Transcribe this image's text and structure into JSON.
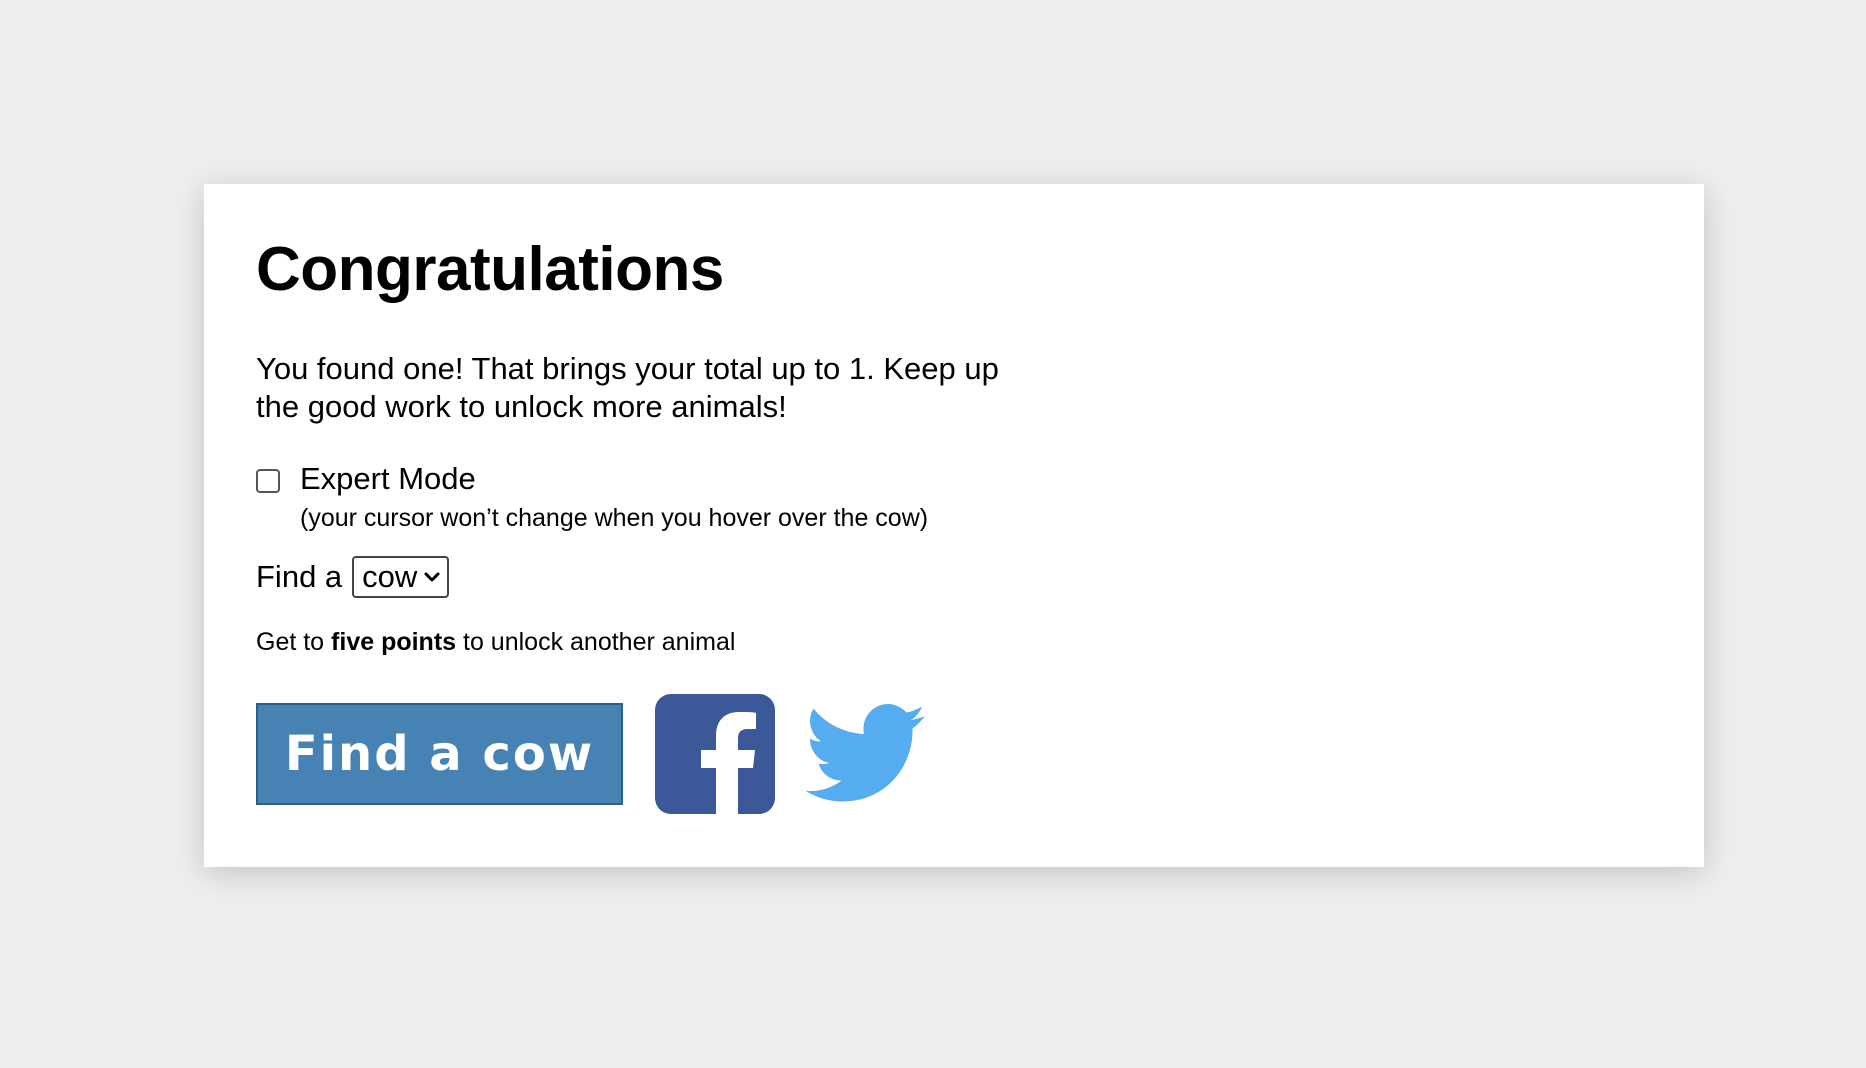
{
  "card": {
    "title": "Congratulations",
    "message": "You found one! That brings your total up to 1. Keep up the good work to unlock more animals!",
    "expert_mode": {
      "label": "Expert Mode",
      "note": "(your cursor won’t change when you hover over the cow)",
      "checked": false
    },
    "find": {
      "lead": "Find a",
      "selected_animal": "cow"
    },
    "goal": {
      "prefix": "Get to",
      "emphasis": "five points",
      "suffix": "to unlock another animal"
    },
    "actions": {
      "find_button_label": "Find a cow",
      "facebook_icon": "facebook-icon",
      "twitter_icon": "twitter-icon"
    }
  },
  "colors": {
    "background": "#eeeeee",
    "card": "#ffffff",
    "button": "#4682b4",
    "facebook": "#3b5998",
    "twitter": "#55acee"
  }
}
